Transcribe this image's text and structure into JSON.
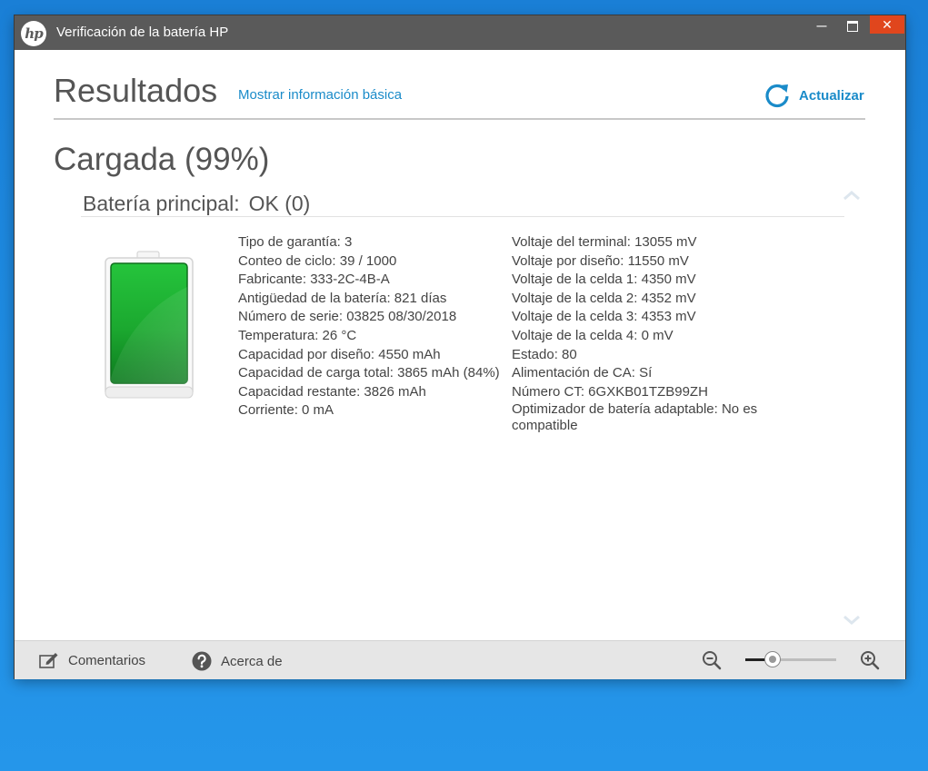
{
  "window": {
    "title": "Verificación de la batería HP",
    "logo_text": "hp",
    "close_glyph": "✕",
    "minimize_glyph": "—"
  },
  "header": {
    "title": "Resultados",
    "basic_info_link": "Mostrar información básica",
    "refresh_label": "Actualizar"
  },
  "status": {
    "charge_text": "Cargada (99%)",
    "charge_percent": 99
  },
  "battery": {
    "section_label": "Batería principal:",
    "section_status": "OK (0)",
    "details_left": [
      "Tipo de garantía: 3",
      "Conteo de ciclo: 39 / 1000",
      "Fabricante: 333-2C-4B-A",
      "Antigüedad de la batería: 821 días",
      "Número de serie: 03825 08/30/2018",
      "Temperatura: 26 °C",
      "Capacidad por diseño: 4550 mAh",
      "Capacidad de carga total: 3865 mAh (84%)",
      "Capacidad restante: 3826 mAh",
      "Corriente: 0 mA"
    ],
    "details_right": [
      "Voltaje del terminal: 13055 mV",
      "Voltaje por diseño: 11550 mV",
      "Voltaje de la celda 1: 4350 mV",
      "Voltaje de la celda 2: 4352 mV",
      "Voltaje de la celda 3: 4353 mV",
      "Voltaje de la celda 4: 0 mV",
      "Estado: 80",
      "Alimentación de CA: Sí",
      "Número CT: 6GXKB01TZB99ZH",
      "Optimizador de batería adaptable: No es compatible"
    ]
  },
  "footer": {
    "comments_label": "Comentarios",
    "about_label": "Acerca de",
    "zoom_level_fraction": 0.3
  },
  "colors": {
    "accent": "#1a8bc9",
    "titlebar": "#5a5a5a",
    "close": "#e0461d",
    "battery_green": "#22b33a"
  }
}
